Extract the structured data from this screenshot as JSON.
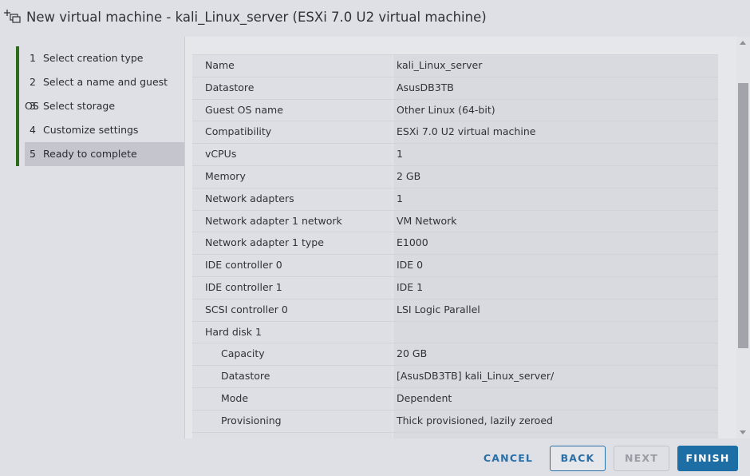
{
  "dialog": {
    "title": "New virtual machine - kali_Linux_server (ESXi 7.0 U2 virtual machine)",
    "icon": "new-vm-icon"
  },
  "steps": [
    {
      "num": "1",
      "label": "Select creation type"
    },
    {
      "num": "2",
      "label": "Select a name and guest OS"
    },
    {
      "num": "3",
      "label": "Select storage"
    },
    {
      "num": "4",
      "label": "Customize settings"
    },
    {
      "num": "5",
      "label": "Ready to complete",
      "active": true
    }
  ],
  "summary": [
    {
      "key": "Name",
      "value": "kali_Linux_server"
    },
    {
      "key": "Datastore",
      "value": "AsusDB3TB"
    },
    {
      "key": "Guest OS name",
      "value": "Other Linux (64-bit)"
    },
    {
      "key": "Compatibility",
      "value": "ESXi 7.0 U2 virtual machine"
    },
    {
      "key": "vCPUs",
      "value": "1"
    },
    {
      "key": "Memory",
      "value": "2 GB"
    },
    {
      "key": "Network adapters",
      "value": "1"
    },
    {
      "key": "Network adapter 1 network",
      "value": "VM Network"
    },
    {
      "key": "Network adapter 1 type",
      "value": "E1000"
    },
    {
      "key": "IDE controller 0",
      "value": "IDE 0"
    },
    {
      "key": "IDE controller 1",
      "value": "IDE 1"
    },
    {
      "key": "SCSI controller 0",
      "value": "LSI Logic Parallel"
    },
    {
      "key": "Hard disk 1",
      "value": ""
    },
    {
      "key": "Capacity",
      "value": "20 GB",
      "sub": true
    },
    {
      "key": "Datastore",
      "value": "[AsusDB3TB] kali_Linux_server/",
      "sub": true
    },
    {
      "key": "Mode",
      "value": "Dependent",
      "sub": true
    },
    {
      "key": "Provisioning",
      "value": "Thick provisioned, lazily zeroed",
      "sub": true
    },
    {
      "key": "",
      "value": "",
      "sub": true
    }
  ],
  "footer": {
    "cancel": "CANCEL",
    "back": "BACK",
    "next": "NEXT",
    "finish": "FINISH"
  },
  "colors": {
    "accent": "#1d6ea4",
    "step_bar": "#2e6b1b",
    "active_step": "#c5c6cd"
  }
}
